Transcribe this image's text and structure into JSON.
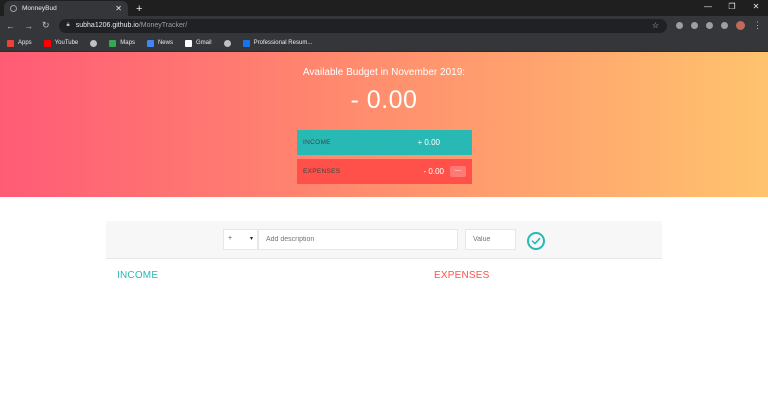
{
  "browser": {
    "tab_title": "MonneyBud",
    "tab_close": "✕",
    "new_tab": "+",
    "window_controls": [
      "—",
      "❐",
      "✕"
    ],
    "url_host": "subha1206.github.io",
    "url_path": "/MoneyTracker/",
    "bookmarks": [
      {
        "label": "Apps",
        "icon": "apps-grid-icon",
        "color": "#ea4335"
      },
      {
        "label": "YouTube",
        "icon": "youtube-icon",
        "color": "#ff0000"
      },
      {
        "label": "",
        "icon": "globe-icon",
        "color": "#bdc1c6"
      },
      {
        "label": "Maps",
        "icon": "maps-icon",
        "color": "#34a853"
      },
      {
        "label": "News",
        "icon": "news-icon",
        "color": "#4285f4"
      },
      {
        "label": "Gmail",
        "icon": "gmail-icon",
        "color": "#ffffff"
      },
      {
        "label": "",
        "icon": "globe-icon",
        "color": "#bdc1c6"
      },
      {
        "label": "Professional Resum...",
        "icon": "resume-icon",
        "color": "#1a73e8"
      }
    ]
  },
  "budget": {
    "title": "Available Budget in November 2019:",
    "value": "- 0.00",
    "income_label": "INCOME",
    "income_value": "+ 0.00",
    "expenses_label": "EXPENSES",
    "expenses_value": "- 0.00",
    "expenses_percentage": "---"
  },
  "add": {
    "type_value": "+",
    "type_arrow": "▾",
    "description_placeholder": "Add description",
    "value_placeholder": "Value"
  },
  "lists": {
    "income_title": "INCOME",
    "expenses_title": "EXPENSES"
  },
  "colors": {
    "income": "#28b9b5",
    "expenses": "#ff5049",
    "gradient_start": "#ff5b76",
    "gradient_end": "#ffc36e"
  }
}
